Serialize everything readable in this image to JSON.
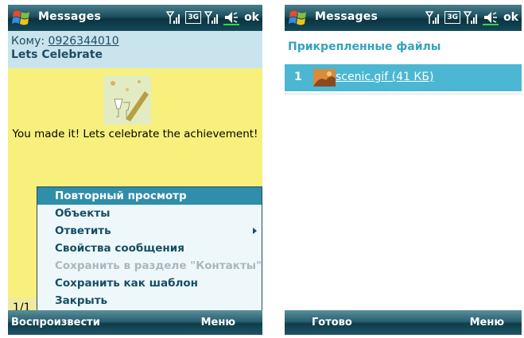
{
  "status": {
    "network": "3G",
    "ok_label": "ok"
  },
  "left": {
    "app_title": "Messages",
    "to_label": "Кому: ",
    "to_number": "0926344010",
    "subject": "Lets Celebrate",
    "body_text": "You made it! Lets celebrate the achievement!",
    "page_indicator": "1/1",
    "menu": [
      {
        "label": "Повторный просмотр",
        "state": "selected"
      },
      {
        "label": "Объекты",
        "state": "normal"
      },
      {
        "label": "Ответить",
        "state": "normal",
        "submenu": true
      },
      {
        "label": "Свойства сообщения",
        "state": "normal"
      },
      {
        "label": "Сохранить в разделе \"Контакты\"",
        "state": "disabled"
      },
      {
        "label": "Сохранить как шаблон",
        "state": "normal"
      },
      {
        "label": "Закрыть",
        "state": "normal"
      }
    ],
    "softkey_left": "Воспроизвести",
    "softkey_right": "Меню"
  },
  "right": {
    "app_title": "Messages",
    "header": "Прикрепленные файлы",
    "attachment": {
      "index": "1",
      "name": "scenic.gif (41 КБ)"
    },
    "softkey_left": "Готово",
    "softkey_right": "Меню"
  },
  "colors": {
    "titlebar": "#0b3340",
    "header_bg": "#c9e4ec",
    "body_bg": "#f8f07c",
    "menu_selected": "#2f8eaa",
    "attach_selected": "#4bb7d2",
    "accent_text": "#36a2bd"
  },
  "icons": [
    "windows-start-icon",
    "signal-icon",
    "3g-icon",
    "signal-icon",
    "speaker-icon"
  ]
}
